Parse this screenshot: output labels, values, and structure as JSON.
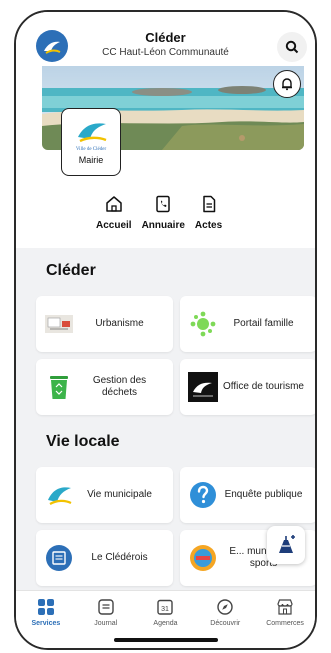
{
  "header": {
    "title": "Cléder",
    "subtitle": "CC Haut-Léon Communauté",
    "logo_icon": "city-logo-icon",
    "search_icon": "search-icon"
  },
  "banner": {
    "image": "coastal-beach-photo",
    "bell_icon": "bell-icon"
  },
  "mairie": {
    "label": "Mairie",
    "logo_text": "Ville de Cléder"
  },
  "quick_nav": [
    {
      "label": "Accueil",
      "icon": "home-icon"
    },
    {
      "label": "Annuaire",
      "icon": "phone-book-icon"
    },
    {
      "label": "Actes",
      "icon": "document-icon"
    }
  ],
  "sections": [
    {
      "title": "Cléder",
      "cards": [
        {
          "label": "Urbanisme",
          "icon": "urbanisme-thumbnail"
        },
        {
          "label": "Portail famille",
          "icon": "portail-famille-icon"
        },
        {
          "label": "Gestion des déchets",
          "icon": "recycle-bin-icon"
        },
        {
          "label": "Office de tourisme",
          "icon": "tourisme-logo"
        }
      ]
    },
    {
      "title": "Vie locale",
      "cards": [
        {
          "label": "Vie municipale",
          "icon": "vie-municipale-logo"
        },
        {
          "label": "Enquête publique",
          "icon": "question-icon"
        },
        {
          "label": "Le Clédérois",
          "icon": "le-cledérois-icon"
        },
        {
          "label": "E... municipaux sports",
          "icon": "sports-badge-icon"
        }
      ]
    }
  ],
  "tabbar": [
    {
      "label": "Services",
      "icon": "grid-icon",
      "active": true
    },
    {
      "label": "Journal",
      "icon": "journal-icon",
      "active": false
    },
    {
      "label": "Agenda",
      "icon": "calendar-icon",
      "active": false,
      "day": "31"
    },
    {
      "label": "Découvrir",
      "icon": "compass-icon",
      "active": false
    },
    {
      "label": "Commerces",
      "icon": "store-icon",
      "active": false
    }
  ],
  "colors": {
    "accent": "#2c6fb7",
    "background": "#f1f2f4"
  }
}
